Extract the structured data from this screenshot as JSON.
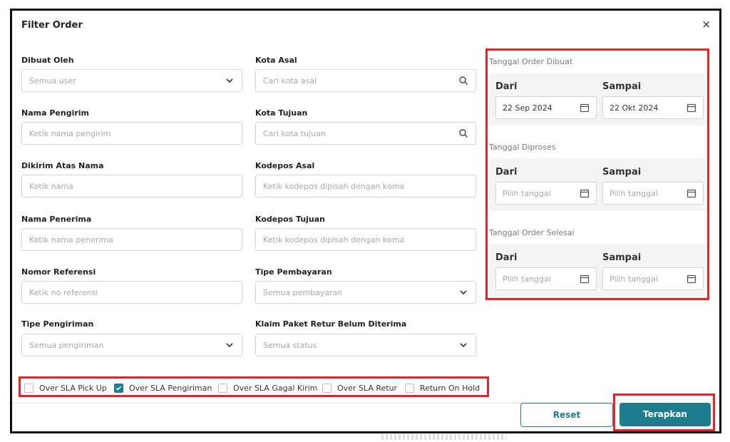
{
  "dialog": {
    "title": "Filter Order",
    "close": "×"
  },
  "left": [
    {
      "label": "Dibuat Oleh",
      "placeholder": "Semua user",
      "kind": "select"
    },
    {
      "label": "Nama Pengirim",
      "placeholder": "Ketik nama pengirim",
      "kind": "text"
    },
    {
      "label": "Dikirim Atas Nama",
      "placeholder": "Ketik nama",
      "kind": "text"
    },
    {
      "label": "Nama Penerima",
      "placeholder": "Ketik nama penerima",
      "kind": "text"
    },
    {
      "label": "Nomor Referensi",
      "placeholder": "Ketik no referensi",
      "kind": "text"
    },
    {
      "label": "Tipe Pengiriman",
      "placeholder": "Semua pengiriman",
      "kind": "select"
    }
  ],
  "middle": [
    {
      "label": "Kota Asal",
      "placeholder": "Cari kota asal",
      "kind": "search"
    },
    {
      "label": "Kota Tujuan",
      "placeholder": "Cari kota tujuan",
      "kind": "search"
    },
    {
      "label": "Kodepos Asal",
      "placeholder": "Ketik kodepos dipisah dengan koma",
      "kind": "text"
    },
    {
      "label": "Kodepos Tujuan",
      "placeholder": "Ketik kodepos dipisah dengan koma",
      "kind": "text"
    },
    {
      "label": "Tipe Pembayaran",
      "placeholder": "Semua pembayaran",
      "kind": "select"
    },
    {
      "label": "Klaim Paket Retur Belum Diterima",
      "placeholder": "Semua status",
      "kind": "select"
    }
  ],
  "dates": [
    {
      "title": "Tanggal Order Dibuat",
      "from_label": "Dari",
      "to_label": "Sampai",
      "from": "22 Sep 2024",
      "to": "22 Okt 2024",
      "filled": true
    },
    {
      "title": "Tanggal Diproses",
      "from_label": "Dari",
      "to_label": "Sampai",
      "from": "Pilih tanggal",
      "to": "Pilih tanggal",
      "filled": false
    },
    {
      "title": "Tanggal Order Selesai",
      "from_label": "Dari",
      "to_label": "Sampai",
      "from": "Pilih tanggal",
      "to": "Pilih tanggal",
      "filled": false
    }
  ],
  "checkboxes": [
    {
      "label": "Over SLA Pick Up",
      "checked": false
    },
    {
      "label": "Over SLA Pengiriman",
      "checked": true
    },
    {
      "label": "Over SLA Gagal Kirim",
      "checked": false
    },
    {
      "label": "Over SLA Retur",
      "checked": false
    },
    {
      "label": "Return On Hold",
      "checked": false
    }
  ],
  "footer": {
    "reset": "Reset",
    "apply": "Terapkan"
  },
  "colors": {
    "accent": "#1d7d8f",
    "highlight": "#e0262b"
  }
}
